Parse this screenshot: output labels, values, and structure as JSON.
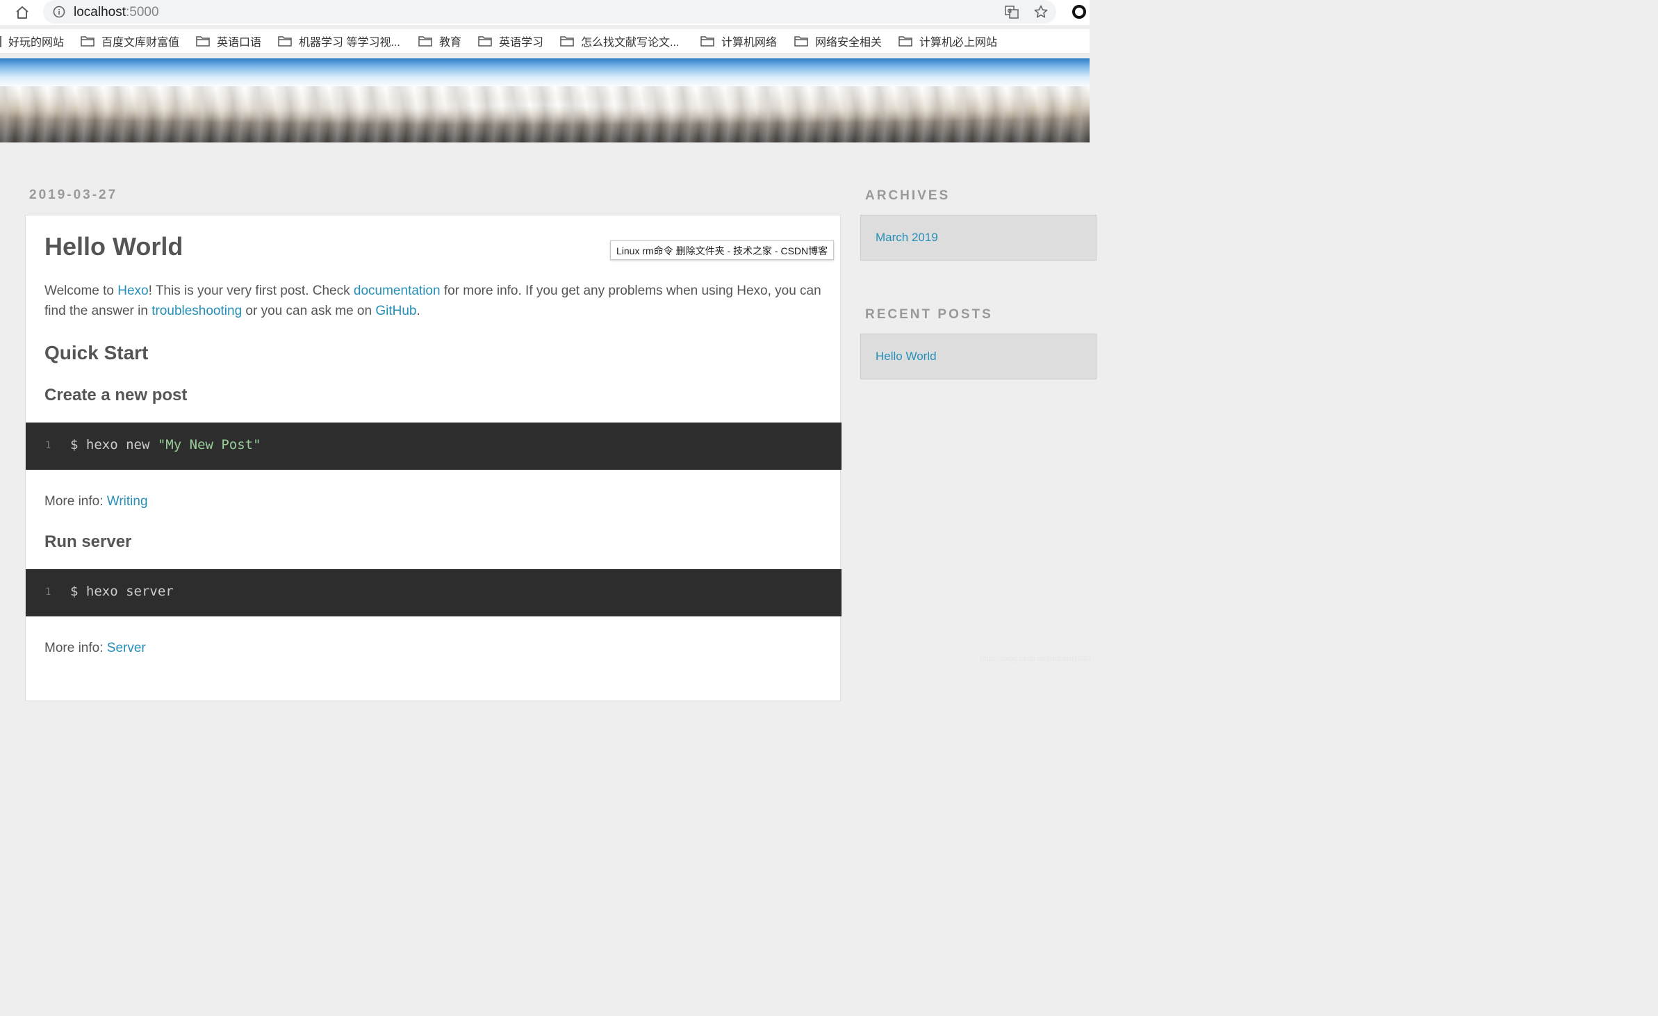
{
  "browser": {
    "url_host": "localhost",
    "url_port": ":5000",
    "bookmarks": [
      "好玩的网站",
      "百度文库财富值",
      "英语口语",
      "机器学习 等学习视...",
      "教育",
      "英语学习",
      "怎么找文献写论文...",
      "计算机网络",
      "网络安全相关",
      "计算机必上网站"
    ]
  },
  "post": {
    "date": "2019-03-27",
    "title": "Hello World",
    "intro": {
      "t1": "Welcome to ",
      "link_hexo": "Hexo",
      "t2": "! This is your very first post. Check ",
      "link_docs": "documentation",
      "t3": " for more info. If you get any problems when using Hexo, you can find the answer in ",
      "link_troubleshooting": "troubleshooting",
      "t4": " or you can ask me on ",
      "link_github": "GitHub",
      "t5": "."
    },
    "quick_start": "Quick Start",
    "create_heading": "Create a new post",
    "code1": {
      "line": "1",
      "cmd": "$ hexo new ",
      "str": "\"My New Post\""
    },
    "more_info_label": "More info: ",
    "more1_link": "Writing",
    "run_heading": "Run server",
    "code2": {
      "line": "1",
      "cmd": "$ hexo server"
    },
    "more2_link": "Server"
  },
  "tooltip": "Linux rm命令 删除文件夹 - 技术之家 - CSDN博客",
  "sidebar": {
    "archives_title": "ARCHIVES",
    "archives_link": "March 2019",
    "recent_title": "RECENT POSTS",
    "recent_link": "Hello World"
  },
  "watermark": "https://blog.csdn.net/richard1230",
  "colors": {
    "link": "#258fb8",
    "code_bg": "#2d2d2d",
    "code_string": "#99cc99"
  }
}
